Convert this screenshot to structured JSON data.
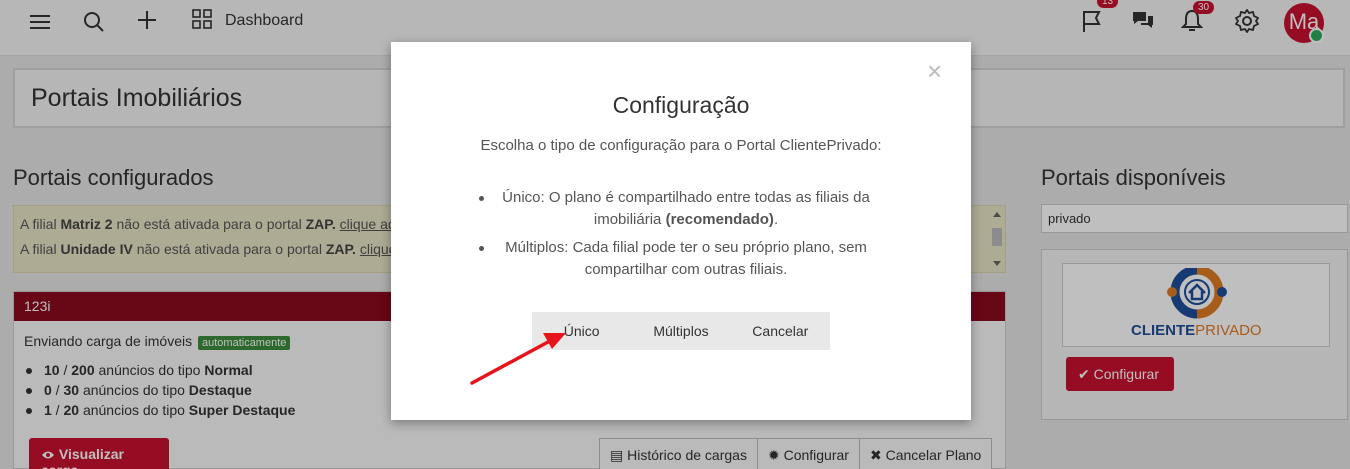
{
  "topbar": {
    "dashboard_label": "Dashboard",
    "flag_badge": "13",
    "bell_badge": "30",
    "avatar_text": "Ma"
  },
  "page": {
    "title": "Portais Imobiliários"
  },
  "configured": {
    "title": "Portais configurados",
    "alert_lines": [
      {
        "prefix": "A filial ",
        "branch": "Matriz 2",
        "middle": " não está ativada para o portal ",
        "portal": "ZAP.",
        "link": "clique aqui"
      },
      {
        "prefix": "A filial ",
        "branch": "Unidade IV",
        "middle": " não está ativada para o portal ",
        "portal": "ZAP.",
        "link": "clique"
      }
    ],
    "panel": {
      "header": "123i",
      "sending_text": "Enviando carga de imóveis",
      "auto_badge": "automaticamente",
      "items": [
        {
          "used": "10",
          "total": "200",
          "text": "anúncios do tipo",
          "type": "Normal"
        },
        {
          "used": "0",
          "total": "30",
          "text": "anúncios do tipo",
          "type": "Destaque"
        },
        {
          "used": "1",
          "total": "20",
          "text": "anúncios do tipo",
          "type": "Super Destaque"
        }
      ],
      "view_button": "Visualizar carga",
      "history_button": "Histórico de cargas",
      "configure_button": "Configurar",
      "cancel_plan_button": "Cancelar Plano"
    }
  },
  "available": {
    "title": "Portais disponíveis",
    "search_value": "privado",
    "logo_word1": "CLIENTE",
    "logo_word2": "PRIVADO",
    "configure_button": "Configurar"
  },
  "modal": {
    "close": "×",
    "title": "Configuração",
    "description": "Escolha o tipo de configuração para o Portal ClientePrivado:",
    "option1_text": "Único: O plano é compartilhado entre todas as filiais da imobiliária",
    "option1_bold": "(recomendado)",
    "option1_end": ".",
    "option2_text": "Múltiplos: Cada filial pode ter o seu próprio plano, sem compartilhar com outras filiais.",
    "buttons": [
      "Único",
      "Múltiplos",
      "Cancelar"
    ]
  },
  "colors": {
    "brand_red": "#c8102e",
    "panel_header": "#8b0a1e",
    "success_green": "#3d8b3d",
    "logo_blue": "#1f4e9c",
    "logo_orange": "#e07b22"
  }
}
